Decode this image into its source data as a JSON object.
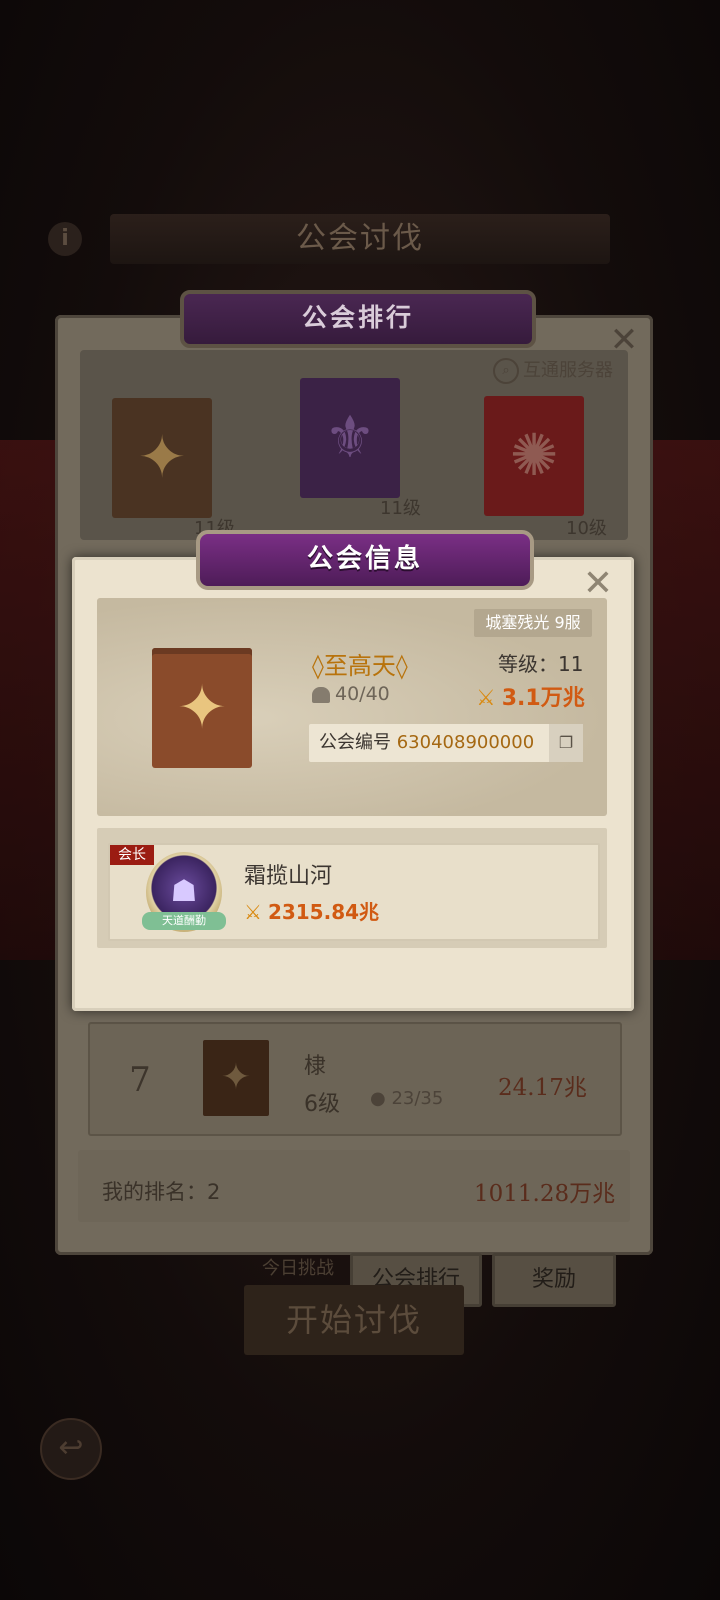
{
  "background": {
    "title": "公会讨伐",
    "info_icon": "info-icon",
    "back_icon": "back-arrow-icon"
  },
  "ranking_panel": {
    "title": "公会排行",
    "server_button": "互通服务器",
    "top3": [
      {
        "level": "11级",
        "emblem": "compass-star-emblem",
        "color": "#4a3322"
      },
      {
        "level": "11级",
        "emblem": "fleur-emblem",
        "color": "#3b2246"
      },
      {
        "level": "10级",
        "emblem": "skull-emblem",
        "color": "#6a1a1a"
      }
    ],
    "row": {
      "rank": "7",
      "name": "棣",
      "level": "6级",
      "members": "23/35",
      "power": "24.17兆"
    },
    "my_rank_label": "我的排名：2",
    "my_power": "1011.28万兆"
  },
  "bottom": {
    "challenge_text": "今日挑战",
    "ranking_button": "公会排行",
    "reward_button": "奖励",
    "start_button": "开始讨伐"
  },
  "guild_info": {
    "title": "公会信息",
    "server_tag": "城塞残光 9服",
    "guild_name": "◊至高天◊",
    "level_label": "等级：",
    "level_value": "11",
    "members": "40/40",
    "power": "3.1万兆",
    "id_label": "公会编号",
    "id_value": "630408900000",
    "leader": {
      "badge": "会长",
      "name": "霜揽山河",
      "power": "2315.84兆",
      "avatar_ribbon": "天道酬勤"
    }
  },
  "colors": {
    "accent_orange": "#d15a12",
    "guild_name_gold": "#b8730c",
    "header_purple": "#6a2775",
    "leader_badge_red": "#9b1c12"
  }
}
